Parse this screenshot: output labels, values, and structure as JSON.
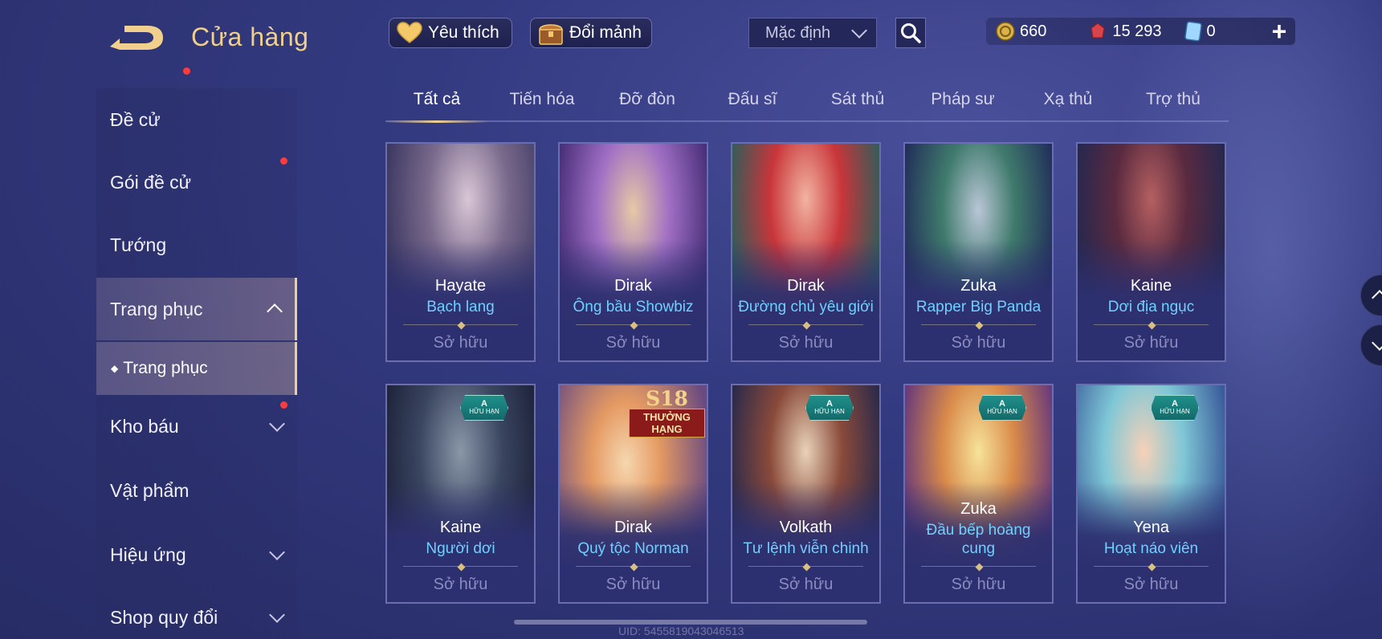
{
  "header": {
    "title": "Cửa hàng",
    "favorites_label": "Yêu thích",
    "exchange_label": "Đổi mảnh",
    "sort_value": "Mặc định"
  },
  "currency": {
    "gold": "660",
    "ruby": "15 293",
    "voucher": "0"
  },
  "sidebar": {
    "items": [
      {
        "label": "Đề cử"
      },
      {
        "label": "Gói đề cử"
      },
      {
        "label": "Tướng"
      },
      {
        "label": "Trang phục"
      },
      {
        "label": "Kho báu"
      },
      {
        "label": "Vật phẩm"
      },
      {
        "label": "Hiệu ứng"
      },
      {
        "label": "Shop quy đổi"
      }
    ],
    "sub_item": "Trang phục"
  },
  "tabs": [
    "Tất cả",
    "Tiến hóa",
    "Đỡ đòn",
    "Đấu sĩ",
    "Sát thủ",
    "Pháp sư",
    "Xạ thủ",
    "Trợ thủ"
  ],
  "cards": [
    {
      "hero": "Hayate",
      "skin": "Bạch lang",
      "status": "Sở hữu"
    },
    {
      "hero": "Dirak",
      "skin": "Ông bầu Showbiz",
      "status": "Sở hữu"
    },
    {
      "hero": "Dirak",
      "skin": "Đường chủ yêu giới",
      "status": "Sở hữu"
    },
    {
      "hero": "Zuka",
      "skin": "Rapper Big Panda",
      "status": "Sở hữu"
    },
    {
      "hero": "Kaine",
      "skin": "Dơi địa ngục",
      "status": "Sở hữu"
    },
    {
      "hero": "Kaine",
      "skin": "Người dơi",
      "status": "Sở hữu",
      "badge": "A"
    },
    {
      "hero": "Dirak",
      "skin": "Quý tộc Norman",
      "status": "Sở hữu",
      "season": "S18",
      "season_rank": "THƯỞNG HẠNG"
    },
    {
      "hero": "Volkath",
      "skin": "Tư lệnh viễn chinh",
      "status": "Sở hữu",
      "badge": "A"
    },
    {
      "hero": "Zuka",
      "skin": "Đầu bếp hoàng cung",
      "status": "Sở hữu",
      "badge": "A"
    },
    {
      "hero": "Yena",
      "skin": "Hoạt náo viên",
      "status": "Sở hữu",
      "badge": "A"
    }
  ],
  "badge_sub": "HỮU HẠN",
  "uid": "UID: 5455819043046513",
  "colors": {
    "accent_gold": "#f1d08d",
    "skin_blue": "#6fd0ff",
    "notification_red": "#ff3b3b"
  }
}
